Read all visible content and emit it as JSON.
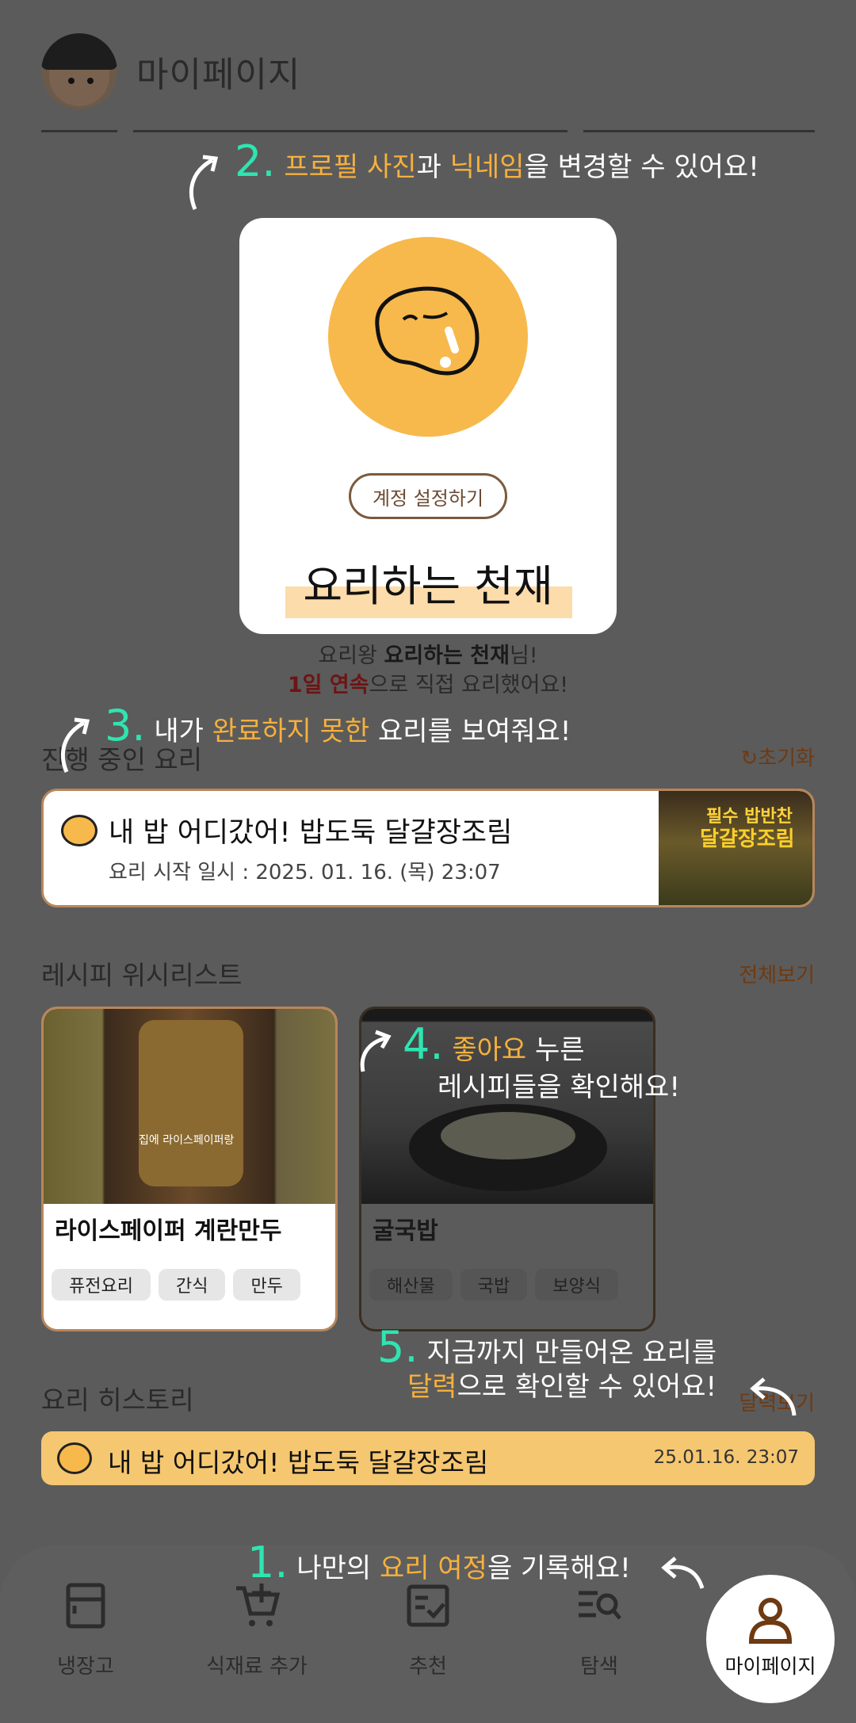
{
  "header": {
    "title": "마이페이지"
  },
  "profile": {
    "account_button": "계정 설정하기",
    "nickname": "요리하는 천재",
    "line1_pre": "요리왕 ",
    "line1_name": "요리하는 천재",
    "line1_post": "님!",
    "line2_bold": "1일 연속",
    "line2_post": "으로 직접 요리했어요!"
  },
  "in_progress": {
    "title": "진행 중인 요리",
    "reset": "초기화",
    "item": {
      "name": "내 밥 어디갔어! 밥도둑 달걀장조림",
      "start": "요리 시작 일시 : 2025. 01. 16. (목) 23:07",
      "thumb_small": "필수 밥반찬",
      "thumb_big": "달걀장조림"
    }
  },
  "wishlist": {
    "title": "레시피 위시리스트",
    "view_all": "전체보기",
    "items": [
      {
        "title": "라이스페이퍼 계란만두",
        "caption": "집에 라이스페이퍼랑",
        "tags": [
          "퓨전요리",
          "간식",
          "만두"
        ]
      },
      {
        "title": "굴국밥",
        "tags": [
          "해산물",
          "국밥",
          "보양식"
        ]
      }
    ]
  },
  "history": {
    "title": "요리 히스토리",
    "calendar_link": "달력보기",
    "item": {
      "name": "내 밥 어디갔어! 밥도둑 달걀장조림",
      "time": "25.01.16. 23:07"
    }
  },
  "nav": {
    "items": [
      {
        "label": "냉장고",
        "icon": "fridge-icon"
      },
      {
        "label": "식재료 추가",
        "icon": "cart-add-icon"
      },
      {
        "label": "추천",
        "icon": "checklist-icon"
      },
      {
        "label": "탐색",
        "icon": "search-list-icon"
      },
      {
        "label": "마이페이지",
        "icon": "person-icon"
      }
    ]
  },
  "tips": {
    "t1": {
      "num": "1.",
      "pre": "나만의 ",
      "hl": "요리 여정",
      "post": "을 기록해요!"
    },
    "t2": {
      "num": "2.",
      "hl1": "프로필 사진",
      "mid": "과 ",
      "hl2": "닉네임",
      "post": "을 변경할 수 있어요!"
    },
    "t3": {
      "num": "3.",
      "pre": "내가 ",
      "hl": "완료하지 못한",
      "post": " 요리를 보여줘요!"
    },
    "t4": {
      "num": "4.",
      "hl": "좋아요",
      "post": " 누른",
      "line2": "레시피들을 확인해요!"
    },
    "t5": {
      "num": "5.",
      "line1": "지금까지 만들어온 요리를",
      "hl": "달력",
      "post": "으로 확인할 수 있어요!"
    }
  },
  "colors": {
    "accent": "#f6b03d",
    "tip_number": "#2ee5b1",
    "brand": "#f7b94c",
    "brown": "#6e3a12"
  }
}
